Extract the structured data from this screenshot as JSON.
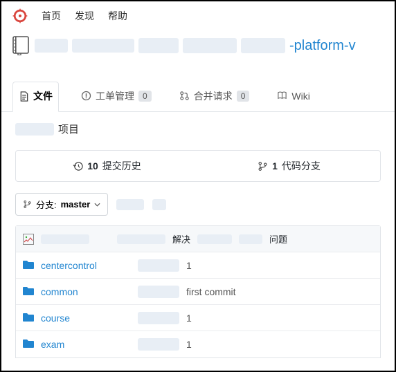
{
  "topnav": {
    "home": "首页",
    "discover": "发现",
    "help": "帮助"
  },
  "repo": {
    "visible_name_suffix": "-platform-v"
  },
  "tabs": {
    "files": "文件",
    "issues": "工单管理",
    "issues_count": "0",
    "pulls": "合并请求",
    "pulls_count": "0",
    "wiki": "Wiki"
  },
  "desc": {
    "suffix": "项目"
  },
  "stats": {
    "commits_count": "10",
    "commits_label": "提交历史",
    "branches_count": "1",
    "branches_label": "代码分支"
  },
  "branch": {
    "prefix": "分支:",
    "name": "master"
  },
  "head_commit": {
    "prefix": "解决",
    "suffix": "问题"
  },
  "files": [
    {
      "name": "centercontrol",
      "commit": "1"
    },
    {
      "name": "common",
      "commit": "first commit"
    },
    {
      "name": "course",
      "commit": "1"
    },
    {
      "name": "exam",
      "commit": "1"
    }
  ]
}
